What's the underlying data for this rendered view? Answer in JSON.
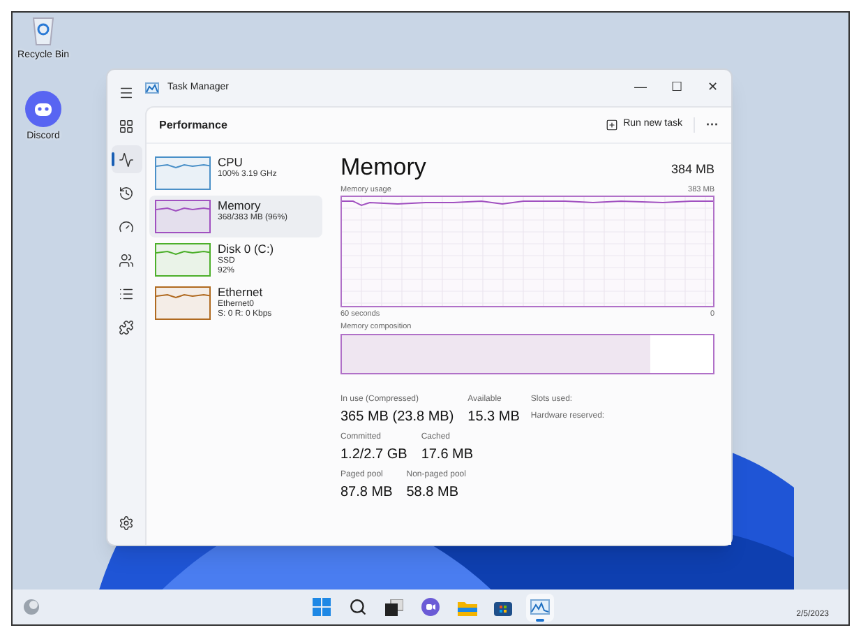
{
  "desktop_icons": [
    {
      "kind": "recycle",
      "label": "Recycle Bin"
    },
    {
      "kind": "discord",
      "label": "Discord"
    }
  ],
  "window": {
    "title": "Task Manager",
    "minimize": "—",
    "maximize": "☐",
    "close": "✕"
  },
  "nav": [
    {
      "kind": "menu",
      "selected": false
    },
    {
      "kind": "processes",
      "selected": false
    },
    {
      "kind": "performance",
      "selected": true
    },
    {
      "kind": "history",
      "selected": false
    },
    {
      "kind": "startup",
      "selected": false
    },
    {
      "kind": "users",
      "selected": false
    },
    {
      "kind": "details",
      "selected": false
    },
    {
      "kind": "services",
      "selected": false
    }
  ],
  "settings_nav": {
    "kind": "settings",
    "selected": false
  },
  "page_title": "Performance",
  "run_new_task": "Run new task",
  "more": "···",
  "devices": [
    {
      "name": "CPU",
      "lines": [
        "100%  3.19 GHz"
      ],
      "color": "#4a90c8",
      "selected": false
    },
    {
      "name": "Memory",
      "lines": [
        "368/383 MB (96%)"
      ],
      "color": "#a050c0",
      "selected": true
    },
    {
      "name": "Disk 0 (C:)",
      "lines": [
        "SSD",
        "92%"
      ],
      "color": "#4caf2a",
      "selected": false
    },
    {
      "name": "Ethernet",
      "lines": [
        "Ethernet0",
        "S: 0  R: 0 Kbps"
      ],
      "color": "#b06a20",
      "selected": false
    }
  ],
  "detail": {
    "title": "Memory",
    "total": "384 MB",
    "graph_label": "Memory usage",
    "graph_max": "383 MB",
    "time_label": "60 seconds",
    "graph_min": "0",
    "composition_label": "Memory composition",
    "composition": {
      "level": 0.83
    }
  },
  "stats": [
    [
      {
        "label": "In use (Compressed)",
        "value": "365 MB (23.8 MB)"
      },
      {
        "label": "Available",
        "value": "15.3 MB"
      }
    ],
    [
      {
        "label": "Committed",
        "value": "1.2/2.7 GB"
      },
      {
        "label": "Cached",
        "value": "17.6 MB"
      }
    ],
    [
      {
        "label": "Paged pool",
        "value": "87.8 MB"
      },
      {
        "label": "Non-paged pool",
        "value": "58.8 MB"
      }
    ]
  ],
  "hardware": [
    "Slots used:",
    "Hardware reserved:"
  ],
  "taskbar": [
    {
      "kind": "start",
      "active": false
    },
    {
      "kind": "search",
      "active": false
    },
    {
      "kind": "taskview",
      "active": false
    },
    {
      "kind": "chat",
      "active": false
    },
    {
      "kind": "explorer",
      "active": false
    },
    {
      "kind": "store",
      "active": false
    },
    {
      "kind": "taskmanager",
      "active": true
    }
  ],
  "clock": {
    "date": "2/5/2023"
  }
}
